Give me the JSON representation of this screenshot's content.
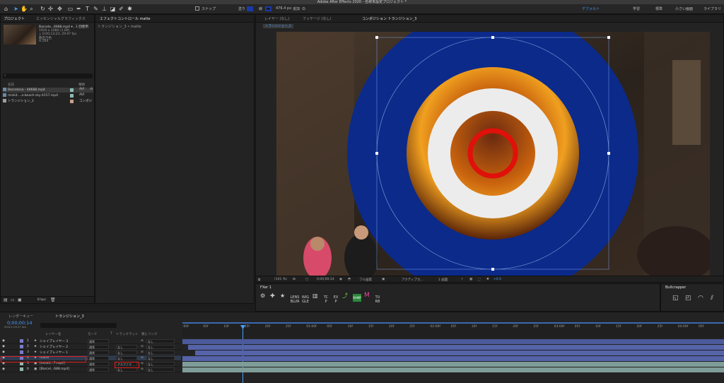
{
  "window": {
    "title": "Adobe After Effects 2020 - 名称未設定プロジェクト *"
  },
  "toolbar": {
    "snap_label": "スナップ",
    "fill_label": "塗り",
    "stroke_label": "線",
    "stroke_width": "476.4 px",
    "add_label": "追加",
    "workspaces": [
      "デフォルト",
      "学習",
      "標準",
      "小さい画面",
      "ライブラリ"
    ],
    "active_workspace": "デフォルト"
  },
  "project_panel": {
    "tabs": [
      "プロジェクト",
      "エッセンシャルグラフィックス"
    ],
    "preview_name": "Barcelo...6688.mp4 ▾ , 1 回使用",
    "preview_size": "1920 x 1080 (1.00)",
    "preview_duration": "△ 0;00;13;23, 29.97 fps",
    "preview_colors": "数百万色",
    "preview_codec": "H.264",
    "search_placeholder": "",
    "col_name": "名前",
    "col_type": "種類",
    "items": [
      {
        "name": "Barcelona - 48688.mp4",
        "type": "AVI",
        "label_color": "#8fb9b0"
      },
      {
        "name": "miskit....a-beach-sky-4157.mp4",
        "type": "AVI",
        "label_color": "#8fb9b0"
      },
      {
        "name": "トランジション_3",
        "type": "コンポジ",
        "label_color": "#c8a08a"
      }
    ],
    "bpc": "8 bpc"
  },
  "effect_panel": {
    "title": "エフェクトコントロール matte",
    "path": "トランジション_3 • matte"
  },
  "viewer": {
    "tabs": [
      "レイヤー (なし)",
      "フッテージ (なし)",
      "コンポジション トランジション_3"
    ],
    "comp_chip": "トランジション_3",
    "zoom": "(141 %)",
    "timecode": "0;00;00;14",
    "resolution": "フル画質",
    "camera": "アクティブカ...",
    "views": "1 画面",
    "exposure": "+0.0"
  },
  "fx_panel": {
    "title": "FXer 1",
    "presets": [
      "LENS BLUR",
      "WIG GLE",
      "3D",
      "TC P",
      "EX P",
      "RAMP",
      "M",
      "TU RB"
    ],
    "right_title": "Bultcrapper"
  },
  "timeline": {
    "tabs": [
      "レンダーキュー",
      "トランジション_3"
    ],
    "current_time": "0;00;00;14",
    "fps_info": "00014 (29.97 fps)",
    "col_name": "レイヤー名",
    "col_mode": "モード",
    "col_t": "T",
    "col_trkmat": "トラックマット",
    "col_parent": "親とリンク",
    "ruler": [
      ":00f",
      "05f",
      "10f",
      "15f",
      "20f",
      "25f",
      "01:00f",
      "05f",
      "10f",
      "15f",
      "20f",
      "25f",
      "02:00f",
      "05f",
      "10f",
      "15f",
      "20f",
      "25f",
      "03:00f",
      "05f",
      "10f",
      "15f",
      "20f",
      "25f",
      "04:00f",
      "05f"
    ],
    "layers": [
      {
        "num": "1",
        "name": "シェイプレイヤー 3",
        "mode": "通常",
        "trkmat": "",
        "parent": "なし",
        "color": "#7a7ac8"
      },
      {
        "num": "2",
        "name": "シェイプレイヤー 2",
        "mode": "通常",
        "trkmat": "なし",
        "parent": "なし",
        "color": "#7a7ac8"
      },
      {
        "num": "3",
        "name": "シェイプレイヤー 1",
        "mode": "通常",
        "trkmat": "なし",
        "parent": "なし",
        "color": "#7a7ac8"
      },
      {
        "num": "4",
        "name": "matte",
        "mode": "通常",
        "trkmat": "なし",
        "parent": "なし",
        "color": "#7a7ac8"
      },
      {
        "num": "5",
        "name": "[miskit...7.mp4]",
        "mode": "通常",
        "trkmat": "アルファマ",
        "parent": "なし",
        "color": "#8fb9b0"
      },
      {
        "num": "6",
        "name": "[Barcel...688.mp4]",
        "mode": "通常",
        "trkmat": "なし",
        "parent": "なし",
        "color": "#8fb9b0"
      }
    ]
  }
}
